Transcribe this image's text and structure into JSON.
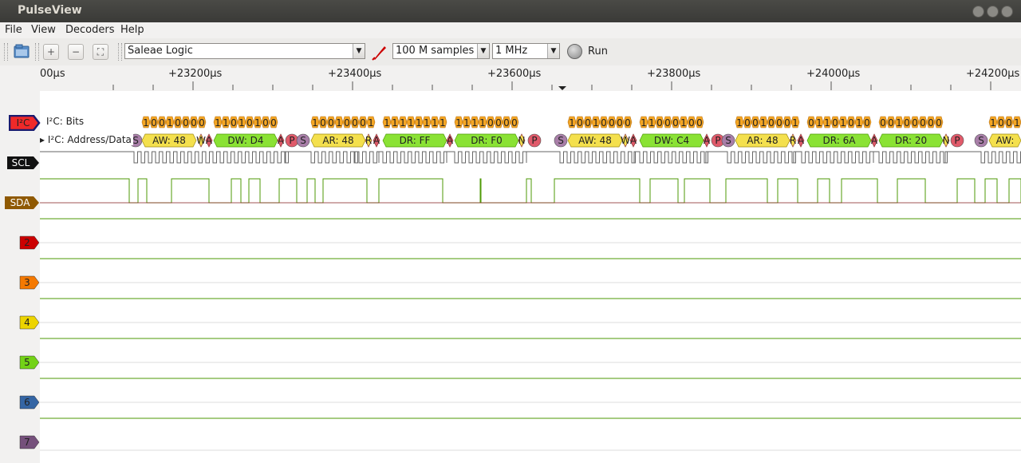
{
  "window": {
    "title": "PulseView"
  },
  "menu": [
    "File",
    "View",
    "Decoders",
    "Help"
  ],
  "toolbar": {
    "device": "Saleae Logic",
    "samples": "100 M samples",
    "samplerate": "1 MHz",
    "run_label": "Run",
    "colors": {
      "probe": "#cc0000"
    }
  },
  "ruler": {
    "ticks": [
      "00µs",
      "+23200µs",
      "+23400µs",
      "+23600µs",
      "+23800µs",
      "+24000µs",
      "+24200µs"
    ]
  },
  "channels": {
    "i2c": {
      "label": "I²C",
      "color": "#ef2929"
    },
    "scl": {
      "label": "SCL",
      "color": "#000000"
    },
    "sda": {
      "label": "SDA",
      "color": "#8f5902"
    },
    "d2": {
      "label": "2",
      "color": "#cc0000"
    },
    "d3": {
      "label": "3",
      "color": "#f57900"
    },
    "d4": {
      "label": "4",
      "color": "#edd400"
    },
    "d5": {
      "label": "5",
      "color": "#73d216"
    },
    "d6": {
      "label": "6",
      "color": "#3465a4"
    },
    "d7": {
      "label": "7",
      "color": "#75507b"
    }
  },
  "decoder": {
    "row_bits": "I²C: Bits",
    "row_addr": "I²C: Address/Data",
    "bits": [
      "10010000",
      "11010100",
      "10010001",
      "11111111",
      "11110000",
      "10010000",
      "11000100",
      "10010001",
      "01101010",
      "00100000",
      "1001"
    ],
    "packets": [
      {
        "type": "S"
      },
      {
        "type": "addr",
        "text": "AW: 48"
      },
      {
        "type": "ack",
        "text": "W"
      },
      {
        "type": "ack",
        "text": "A"
      },
      {
        "type": "data",
        "text": "DW: D4"
      },
      {
        "type": "ack",
        "text": "A"
      },
      {
        "type": "stop",
        "text": "P"
      },
      {
        "type": "S"
      },
      {
        "type": "addr",
        "text": "AR: 48"
      },
      {
        "type": "ack",
        "text": "R"
      },
      {
        "type": "ack",
        "text": "A"
      },
      {
        "type": "data",
        "text": "DR: FF"
      },
      {
        "type": "ack",
        "text": "A"
      },
      {
        "type": "data",
        "text": "DR: F0"
      },
      {
        "type": "ack",
        "text": "N"
      },
      {
        "type": "stop",
        "text": "P"
      },
      {
        "type": "S"
      },
      {
        "type": "addr",
        "text": "AW: 48"
      },
      {
        "type": "ack",
        "text": "W"
      },
      {
        "type": "ack",
        "text": "A"
      },
      {
        "type": "data",
        "text": "DW: C4"
      },
      {
        "type": "ack",
        "text": "A"
      },
      {
        "type": "stop",
        "text": "P"
      },
      {
        "type": "S"
      },
      {
        "type": "addr",
        "text": "AR: 48"
      },
      {
        "type": "ack",
        "text": "R"
      },
      {
        "type": "ack",
        "text": "A"
      },
      {
        "type": "data",
        "text": "DR: 6A"
      },
      {
        "type": "ack",
        "text": "A"
      },
      {
        "type": "data",
        "text": "DR: 20"
      },
      {
        "type": "ack",
        "text": "N"
      },
      {
        "type": "stop",
        "text": "P"
      },
      {
        "type": "S"
      },
      {
        "type": "addr",
        "text": "AW:"
      }
    ]
  }
}
